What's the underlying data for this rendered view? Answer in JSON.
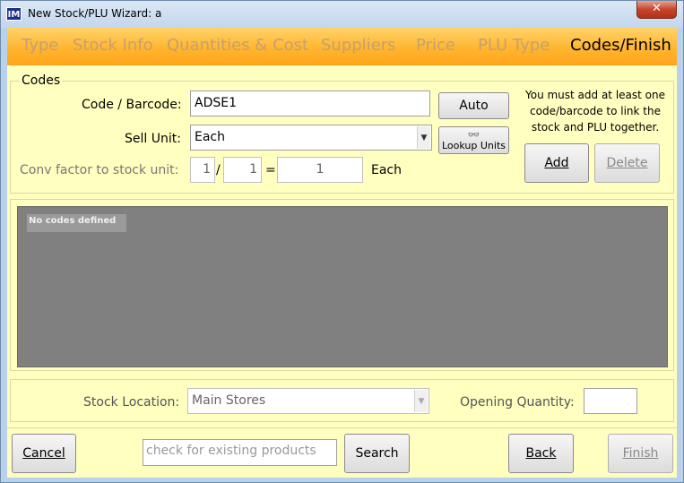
{
  "window": {
    "title": "New Stock/PLU Wizard: a",
    "app_icon": "IM",
    "close_glyph": "✕"
  },
  "tabs": [
    {
      "label": "Type",
      "active": false
    },
    {
      "label": "Stock Info",
      "active": false
    },
    {
      "label": "Quantities & Cost",
      "active": false
    },
    {
      "label": "Suppliers",
      "active": false
    },
    {
      "label": "Price",
      "active": false
    },
    {
      "label": "PLU Type",
      "active": false
    },
    {
      "label": "Codes/Finish",
      "active": true
    }
  ],
  "codes": {
    "legend": "Codes",
    "code_label": "Code / Barcode:",
    "code_value": "ADSE1",
    "auto_label": "Auto",
    "sell_unit_label": "Sell Unit:",
    "sell_unit_value": "Each",
    "lookup_label": "Lookup Units",
    "lookup_icon": "glasses-icon",
    "conv_label": "Conv factor to stock unit:",
    "conv_num": "1",
    "conv_slash": "/",
    "conv_den": "1",
    "conv_eq": "=",
    "conv_result": "1",
    "conv_unit": "Each",
    "note": "You must add at least one code/barcode to link the stock and PLU together.",
    "add_label": "Add",
    "delete_label": "Delete",
    "empty_text": "No codes defined"
  },
  "location": {
    "stock_location_label": "Stock Location:",
    "stock_location_value": "Main Stores",
    "opening_qty_label": "Opening Quantity:",
    "opening_qty_value": ""
  },
  "footer": {
    "cancel_label": "Cancel",
    "search_placeholder": "check for existing products",
    "search_label": "Search",
    "back_label": "Back",
    "finish_label": "Finish"
  },
  "colors": {
    "panel_bg": "#ffffc0",
    "tab_bar": "#ffb52e",
    "list_bg": "#808080"
  }
}
